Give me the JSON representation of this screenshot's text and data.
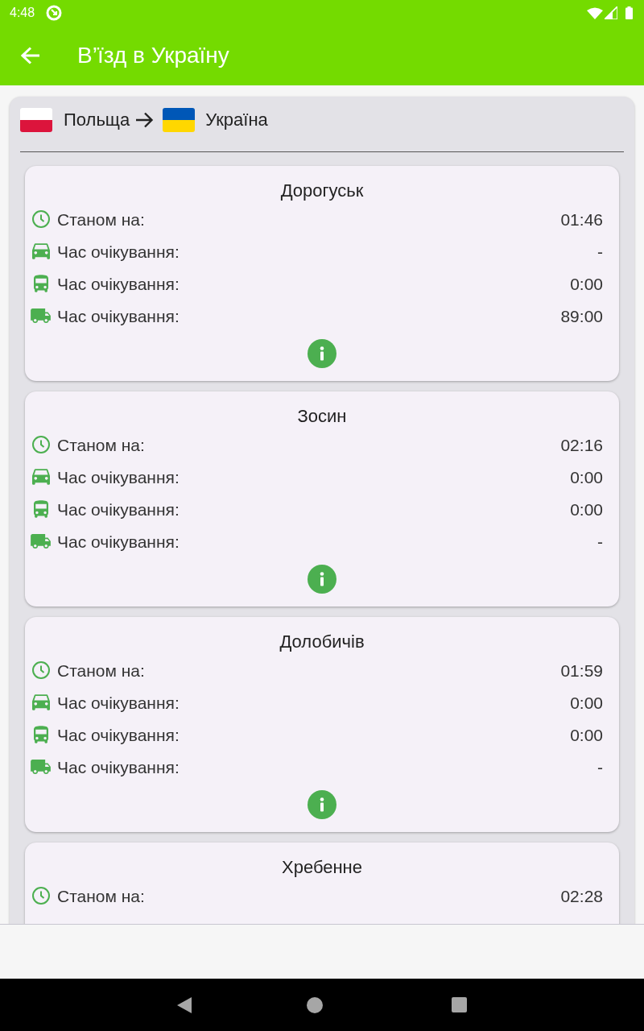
{
  "status_bar": {
    "time": "4:48"
  },
  "app_bar": {
    "title": "В’їзд в Україну"
  },
  "route": {
    "from": "Польща",
    "to": "Україна"
  },
  "checkpoints": [
    {
      "name": "Дорогуськ",
      "info": true,
      "rows": [
        {
          "kind": "clock",
          "label": "Станом на:",
          "value": "01:46"
        },
        {
          "kind": "car",
          "label": "Час очікування:",
          "value": "-"
        },
        {
          "kind": "bus",
          "label": "Час очікування:",
          "value": "0:00"
        },
        {
          "kind": "truck",
          "label": "Час очікування:",
          "value": "89:00"
        }
      ]
    },
    {
      "name": "Зосин",
      "info": true,
      "rows": [
        {
          "kind": "clock",
          "label": "Станом на:",
          "value": "02:16"
        },
        {
          "kind": "car",
          "label": "Час очікування:",
          "value": "0:00"
        },
        {
          "kind": "bus",
          "label": "Час очікування:",
          "value": "0:00"
        },
        {
          "kind": "truck",
          "label": "Час очікування:",
          "value": "-"
        }
      ]
    },
    {
      "name": "Долобичів",
      "info": true,
      "rows": [
        {
          "kind": "clock",
          "label": "Станом на:",
          "value": "01:59"
        },
        {
          "kind": "car",
          "label": "Час очікування:",
          "value": "0:00"
        },
        {
          "kind": "bus",
          "label": "Час очікування:",
          "value": "0:00"
        },
        {
          "kind": "truck",
          "label": "Час очікування:",
          "value": "-"
        }
      ]
    },
    {
      "name": "Хребенне",
      "info": false,
      "rows": [
        {
          "kind": "clock",
          "label": "Станом на:",
          "value": "02:28"
        }
      ]
    }
  ]
}
